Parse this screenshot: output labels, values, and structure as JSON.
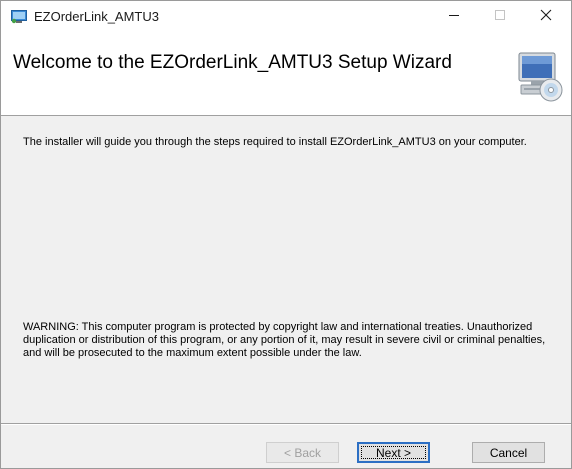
{
  "window": {
    "title": "EZOrderLink_AMTU3",
    "app_icon": "installer-app-icon",
    "controls": {
      "minimize_icon": "minimize-icon",
      "maximize_icon": "maximize-icon",
      "close_icon": "close-icon"
    }
  },
  "banner": {
    "title": "Welcome to the EZOrderLink_AMTU3 Setup Wizard",
    "art_icon": "computer-cd-icon"
  },
  "body": {
    "intro": "The installer will guide you through the steps required to install EZOrderLink_AMTU3 on your computer.",
    "warning": "WARNING: This computer program is protected by copyright law and international treaties. Unauthorized duplication or distribution of this program, or any portion of it, may result in severe civil or criminal penalties, and will be prosecuted to the maximum extent possible under the law."
  },
  "footer": {
    "back_label": "< Back",
    "next_label": "Next >",
    "cancel_label": "Cancel",
    "back_enabled": false
  },
  "colors": {
    "window_bg": "#f0f0f0",
    "header_bg": "#ffffff",
    "focus_border": "#2c6fc4"
  }
}
